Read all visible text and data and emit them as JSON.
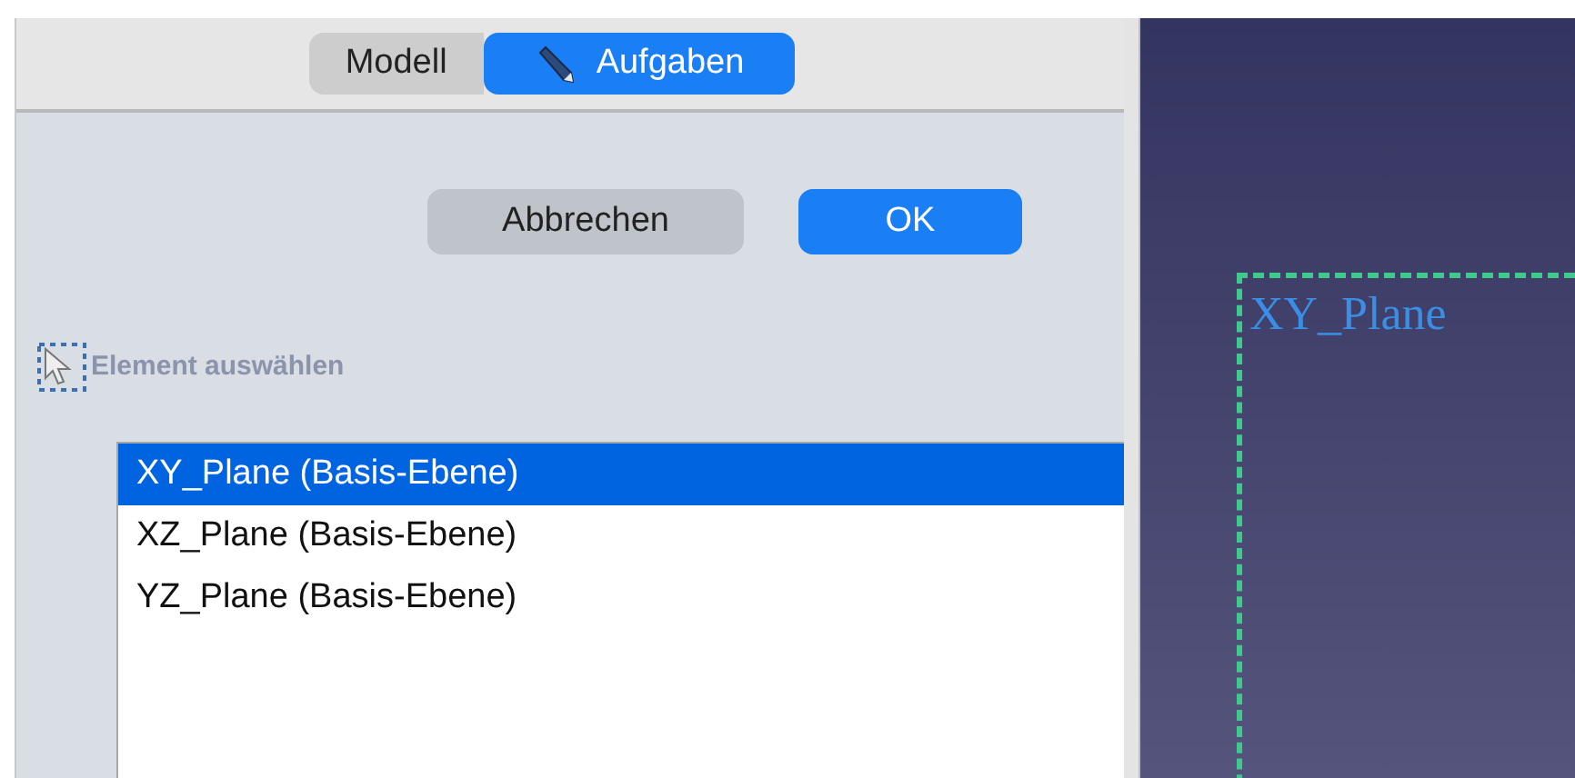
{
  "tabs": [
    {
      "label": "Modell",
      "selected": false,
      "kind": "plain"
    },
    {
      "label": "Aufgaben",
      "selected": true,
      "kind": "pencil"
    }
  ],
  "buttons": [
    {
      "label": "Abbrechen",
      "kind": "secondary"
    },
    {
      "label": "OK",
      "kind": "primary"
    }
  ],
  "select_hint": "Element auswählen",
  "list": [
    {
      "label": "XY_Plane (Basis-Ebene)",
      "selected": true
    },
    {
      "label": "XZ_Plane (Basis-Ebene)",
      "selected": false
    },
    {
      "label": "YZ_Plane (Basis-Ebene)",
      "selected": false
    }
  ],
  "viewport": {
    "plane_label": "XY_Plane"
  }
}
